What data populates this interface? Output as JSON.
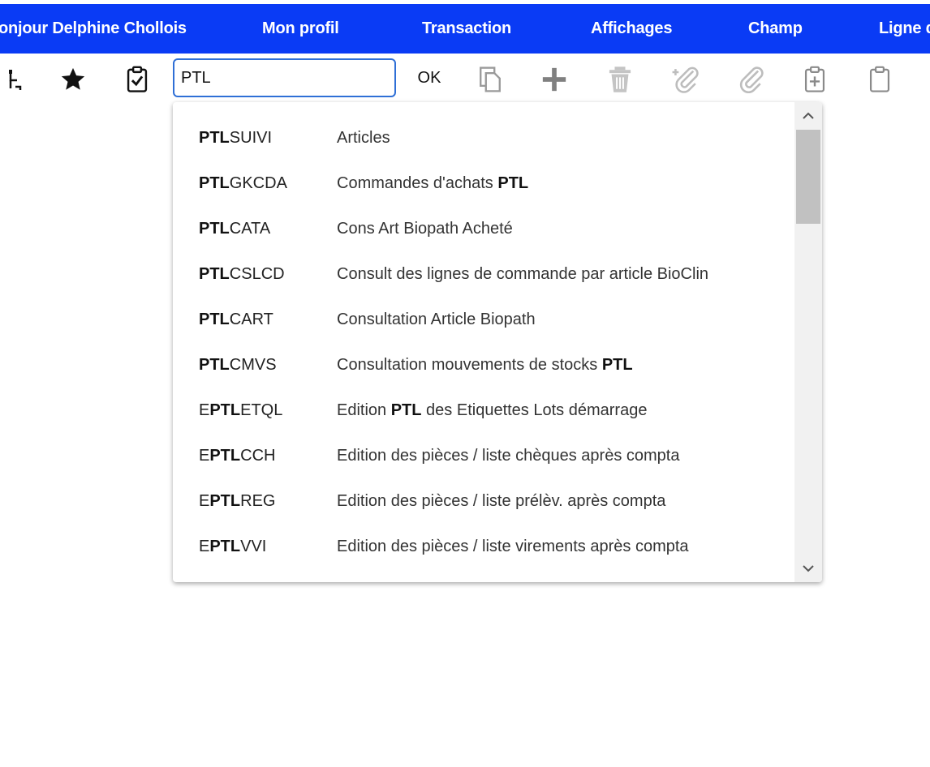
{
  "menubar": {
    "items": [
      {
        "label": "onjour Delphine Chollois"
      },
      {
        "label": "Mon profil"
      },
      {
        "label": "Transaction"
      },
      {
        "label": "Affichages"
      },
      {
        "label": "Champ"
      },
      {
        "label": "Ligne d"
      }
    ],
    "background": "#0a3bf5"
  },
  "toolbar": {
    "icons": [
      "user-tree-icon",
      "star-icon",
      "clipboard-check-icon",
      "copy-icon",
      "plus-icon",
      "trash-icon",
      "add-attachment-icon",
      "attachment-icon",
      "clipboard-plus-icon",
      "clipboard-icon"
    ],
    "search_value": "PTL",
    "ok_label": "OK"
  },
  "dropdown": {
    "items": [
      {
        "code_pre": "",
        "code_match": "PTL",
        "code_rest": "SUIVI",
        "desc_pre": "Articles",
        "desc_match": "",
        "desc_post": ""
      },
      {
        "code_pre": "",
        "code_match": "PTL",
        "code_rest": "GKCDA",
        "desc_pre": "Commandes d'achats ",
        "desc_match": "PTL",
        "desc_post": ""
      },
      {
        "code_pre": "",
        "code_match": "PTL",
        "code_rest": "CATA",
        "desc_pre": "Cons Art Biopath Acheté",
        "desc_match": "",
        "desc_post": ""
      },
      {
        "code_pre": "",
        "code_match": "PTL",
        "code_rest": "CSLCD",
        "desc_pre": "Consult des lignes de commande par article BioClin",
        "desc_match": "",
        "desc_post": ""
      },
      {
        "code_pre": "",
        "code_match": "PTL",
        "code_rest": "CART",
        "desc_pre": "Consultation Article Biopath",
        "desc_match": "",
        "desc_post": ""
      },
      {
        "code_pre": "",
        "code_match": "PTL",
        "code_rest": "CMVS",
        "desc_pre": "Consultation mouvements de stocks ",
        "desc_match": "PTL",
        "desc_post": ""
      },
      {
        "code_pre": "E",
        "code_match": "PTL",
        "code_rest": "ETQL",
        "desc_pre": "Edition ",
        "desc_match": "PTL",
        "desc_post": " des Etiquettes Lots démarrage"
      },
      {
        "code_pre": "E",
        "code_match": "PTL",
        "code_rest": "CCH",
        "desc_pre": "Edition des pièces / liste chèques après compta",
        "desc_match": "",
        "desc_post": ""
      },
      {
        "code_pre": "E",
        "code_match": "PTL",
        "code_rest": "REG",
        "desc_pre": "Edition des pièces / liste prélèv. après compta",
        "desc_match": "",
        "desc_post": ""
      },
      {
        "code_pre": "E",
        "code_match": "PTL",
        "code_rest": "VVI",
        "desc_pre": "Edition des pièces / liste virements après compta",
        "desc_match": "",
        "desc_post": ""
      }
    ],
    "scroll": {
      "up": "chevron-up-icon",
      "down": "chevron-down-icon"
    }
  }
}
